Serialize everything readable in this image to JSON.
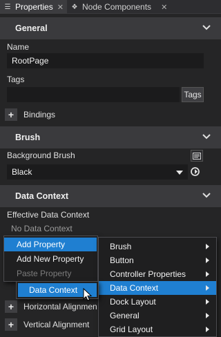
{
  "tabs": [
    {
      "label": "Properties",
      "icon": "list-icon"
    },
    {
      "label": "Node Components",
      "icon": "component-icon"
    }
  ],
  "general": {
    "section_title": "General",
    "name_label": "Name",
    "name_value": "RootPage",
    "tags_label": "Tags",
    "tags_value": "",
    "tags_button": "Tags",
    "bindings_label": "Bindings"
  },
  "brush": {
    "section_title": "Brush",
    "background_label": "Background Brush",
    "background_value": "Black"
  },
  "data_context": {
    "section_title": "Data Context",
    "effective_label": "Effective Data Context",
    "effective_value": "No Data Context"
  },
  "collapsed_properties": [
    "Horizontal Alignment",
    "Vertical Alignment"
  ],
  "context_menu": {
    "items": [
      {
        "label": "Add Property",
        "highlighted": true,
        "enabled": true
      },
      {
        "label": "Add New Property",
        "highlighted": false,
        "enabled": true
      },
      {
        "label": "Paste Property",
        "highlighted": false,
        "enabled": false
      }
    ]
  },
  "categories_menu": {
    "items": [
      {
        "label": "Brush"
      },
      {
        "label": "Button"
      },
      {
        "label": "Controller Properties"
      },
      {
        "label": "Data Context",
        "highlighted": true
      },
      {
        "label": "Dock Layout"
      },
      {
        "label": "General"
      },
      {
        "label": "Grid Layout"
      }
    ]
  },
  "submenu": {
    "items": [
      {
        "label": "Data Context",
        "highlighted": true
      }
    ]
  },
  "colors": {
    "panel_bg": "#252526",
    "section_bg": "#3a3a3d",
    "highlight": "#1f7fd1"
  }
}
